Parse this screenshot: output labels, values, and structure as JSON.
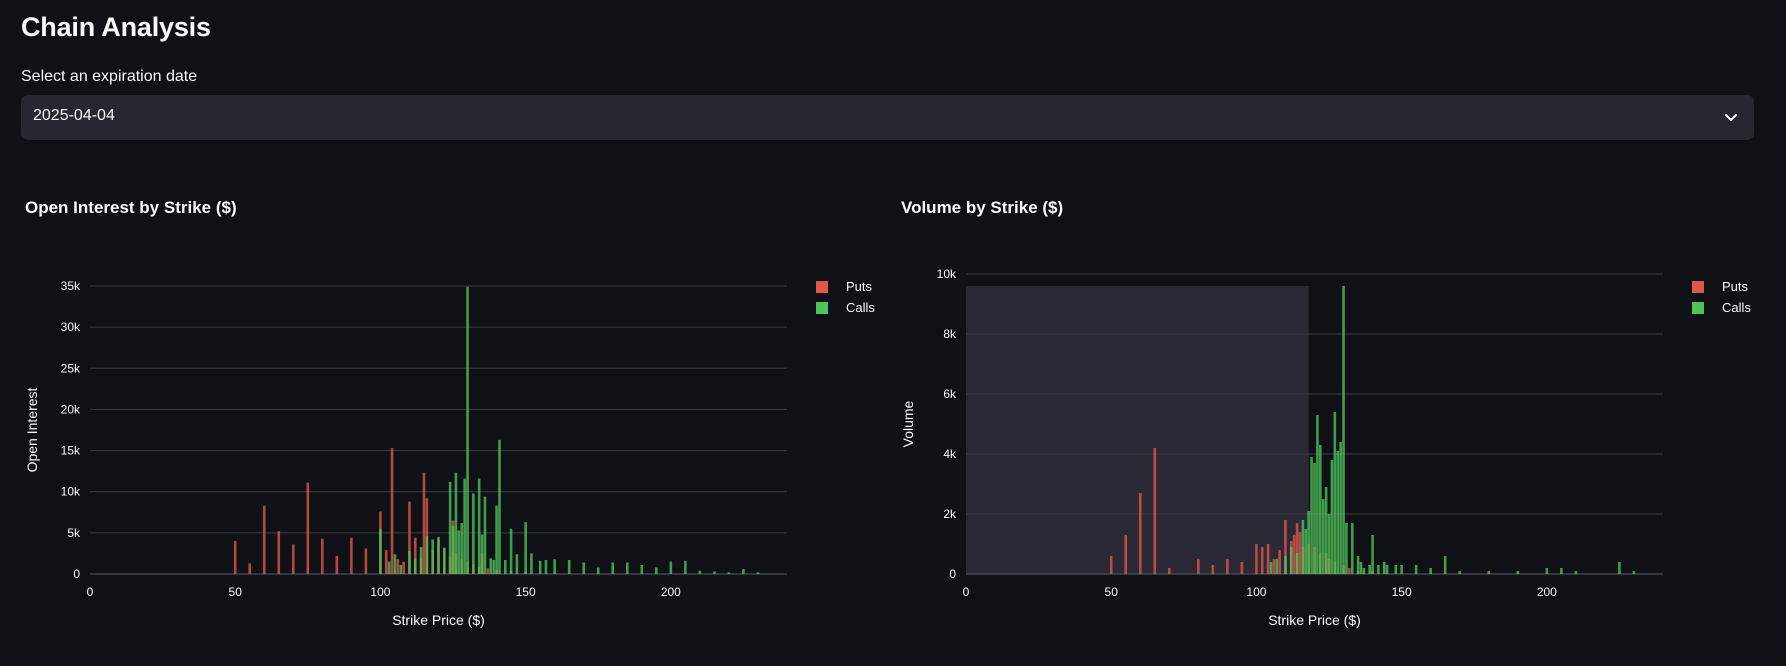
{
  "page": {
    "title": "Chain Analysis"
  },
  "expiration_select": {
    "label": "Select an expiration date",
    "value": "2025-04-04",
    "icon": "chevron-down-icon"
  },
  "colors": {
    "puts": "#e0584b",
    "calls": "#4fc45a",
    "background": "#0f1116",
    "select_bg": "#262730"
  },
  "chart_data": [
    {
      "type": "bar",
      "title": "Open Interest by Strike ($)",
      "xlabel": "Strike Price ($)",
      "ylabel": "Open Interest",
      "xlim": [
        0,
        240
      ],
      "ylim": [
        0,
        35000
      ],
      "x_ticks": [
        0,
        50,
        100,
        150,
        200
      ],
      "x_tick_labels": [
        "0",
        "50",
        "100",
        "150",
        "200"
      ],
      "y_ticks": [
        0,
        5000,
        10000,
        15000,
        20000,
        25000,
        30000,
        35000
      ],
      "y_tick_labels": [
        "0",
        "5k",
        "10k",
        "15k",
        "20k",
        "25k",
        "30k",
        "35k"
      ],
      "grid": true,
      "legend_position": "top-right",
      "legend": [
        "Puts",
        "Calls"
      ],
      "series": [
        {
          "name": "Puts",
          "color": "#e0584b",
          "points": [
            [
              50,
              4000
            ],
            [
              55,
              1300
            ],
            [
              60,
              8300
            ],
            [
              65,
              5200
            ],
            [
              70,
              3600
            ],
            [
              75,
              11100
            ],
            [
              80,
              4300
            ],
            [
              85,
              2200
            ],
            [
              90,
              4400
            ],
            [
              95,
              3100
            ],
            [
              100,
              7600
            ],
            [
              102,
              2900
            ],
            [
              104,
              15300
            ],
            [
              106,
              1800
            ],
            [
              108,
              1500
            ],
            [
              110,
              8800
            ],
            [
              112,
              4400
            ],
            [
              114,
              2000
            ],
            [
              115,
              12300
            ],
            [
              116,
              9200
            ],
            [
              118,
              2900
            ],
            [
              120,
              4200
            ],
            [
              122,
              3000
            ],
            [
              124,
              2100
            ],
            [
              125,
              6500
            ],
            [
              126,
              2500
            ],
            [
              128,
              1800
            ],
            [
              130,
              1500
            ],
            [
              132,
              1200
            ],
            [
              134,
              900
            ],
            [
              135,
              2500
            ],
            [
              137,
              700
            ],
            [
              140,
              500
            ],
            [
              145,
              400
            ],
            [
              150,
              300
            ]
          ]
        },
        {
          "name": "Calls",
          "color": "#4fc45a",
          "points": [
            [
              100,
              5500
            ],
            [
              103,
              1500
            ],
            [
              105,
              2400
            ],
            [
              107,
              1100
            ],
            [
              110,
              2800
            ],
            [
              112,
              1900
            ],
            [
              114,
              3300
            ],
            [
              116,
              4600
            ],
            [
              118,
              4200
            ],
            [
              120,
              4500
            ],
            [
              122,
              3200
            ],
            [
              124,
              11200
            ],
            [
              125,
              5800
            ],
            [
              126,
              12300
            ],
            [
              127,
              5300
            ],
            [
              128,
              6200
            ],
            [
              129,
              11600
            ],
            [
              130,
              34900
            ],
            [
              132,
              9800
            ],
            [
              134,
              11600
            ],
            [
              135,
              4800
            ],
            [
              136,
              9400
            ],
            [
              138,
              1900
            ],
            [
              139,
              1700
            ],
            [
              140,
              8300
            ],
            [
              141,
              16300
            ],
            [
              143,
              1700
            ],
            [
              145,
              5500
            ],
            [
              147,
              2400
            ],
            [
              150,
              6300
            ],
            [
              152,
              2500
            ],
            [
              155,
              1600
            ],
            [
              157,
              1700
            ],
            [
              160,
              1800
            ],
            [
              165,
              1700
            ],
            [
              170,
              1400
            ],
            [
              175,
              800
            ],
            [
              180,
              1400
            ],
            [
              185,
              1400
            ],
            [
              190,
              1100
            ],
            [
              195,
              800
            ],
            [
              200,
              1500
            ],
            [
              205,
              1600
            ],
            [
              210,
              400
            ],
            [
              215,
              300
            ],
            [
              220,
              200
            ],
            [
              225,
              600
            ],
            [
              230,
              200
            ]
          ]
        }
      ]
    },
    {
      "type": "bar",
      "title": "Volume by Strike ($)",
      "xlabel": "Strike Price ($)",
      "ylabel": "Volume",
      "xlim": [
        0,
        240
      ],
      "ylim": [
        0,
        10000
      ],
      "x_ticks": [
        0,
        50,
        100,
        150,
        200
      ],
      "x_tick_labels": [
        "0",
        "50",
        "100",
        "150",
        "200"
      ],
      "y_ticks": [
        0,
        2000,
        4000,
        6000,
        8000,
        10000
      ],
      "y_tick_labels": [
        "0",
        "2k",
        "4k",
        "6k",
        "8k",
        "10k"
      ],
      "grid": true,
      "legend_position": "top-right",
      "legend": [
        "Puts",
        "Calls"
      ],
      "highlight_region": {
        "x": [
          0,
          118
        ],
        "y": [
          0,
          9600
        ]
      },
      "series": [
        {
          "name": "Puts",
          "color": "#e0584b",
          "points": [
            [
              50,
              600
            ],
            [
              55,
              1300
            ],
            [
              60,
              2700
            ],
            [
              65,
              4200
            ],
            [
              70,
              200
            ],
            [
              80,
              500
            ],
            [
              85,
              300
            ],
            [
              90,
              500
            ],
            [
              95,
              400
            ],
            [
              100,
              1000
            ],
            [
              102,
              900
            ],
            [
              104,
              1000
            ],
            [
              106,
              500
            ],
            [
              108,
              800
            ],
            [
              110,
              1800
            ],
            [
              112,
              1100
            ],
            [
              113,
              1300
            ],
            [
              114,
              1700
            ],
            [
              115,
              1400
            ],
            [
              116,
              900
            ],
            [
              118,
              1000
            ],
            [
              120,
              900
            ],
            [
              122,
              700
            ],
            [
              124,
              700
            ],
            [
              125,
              500
            ],
            [
              127,
              400
            ],
            [
              130,
              300
            ],
            [
              132,
              200
            ],
            [
              135,
              100
            ],
            [
              140,
              100
            ]
          ]
        },
        {
          "name": "Calls",
          "color": "#4fc45a",
          "points": [
            [
              105,
              400
            ],
            [
              107,
              500
            ],
            [
              110,
              600
            ],
            [
              112,
              900
            ],
            [
              114,
              700
            ],
            [
              116,
              1800
            ],
            [
              117,
              1500
            ],
            [
              118,
              2100
            ],
            [
              119,
              3900
            ],
            [
              120,
              3700
            ],
            [
              121,
              5300
            ],
            [
              122,
              4300
            ],
            [
              123,
              2500
            ],
            [
              124,
              2900
            ],
            [
              125,
              2000
            ],
            [
              126,
              3800
            ],
            [
              127,
              5400
            ],
            [
              128,
              4100
            ],
            [
              129,
              4400
            ],
            [
              130,
              9600
            ],
            [
              131,
              1700
            ],
            [
              133,
              1700
            ],
            [
              135,
              600
            ],
            [
              136,
              400
            ],
            [
              137,
              200
            ],
            [
              139,
              300
            ],
            [
              140,
              1300
            ],
            [
              142,
              300
            ],
            [
              144,
              400
            ],
            [
              145,
              300
            ],
            [
              148,
              300
            ],
            [
              150,
              300
            ],
            [
              155,
              300
            ],
            [
              160,
              200
            ],
            [
              165,
              600
            ],
            [
              170,
              100
            ],
            [
              180,
              100
            ],
            [
              190,
              100
            ],
            [
              200,
              200
            ],
            [
              205,
              200
            ],
            [
              210,
              100
            ],
            [
              225,
              400
            ],
            [
              230,
              100
            ]
          ]
        }
      ]
    }
  ]
}
